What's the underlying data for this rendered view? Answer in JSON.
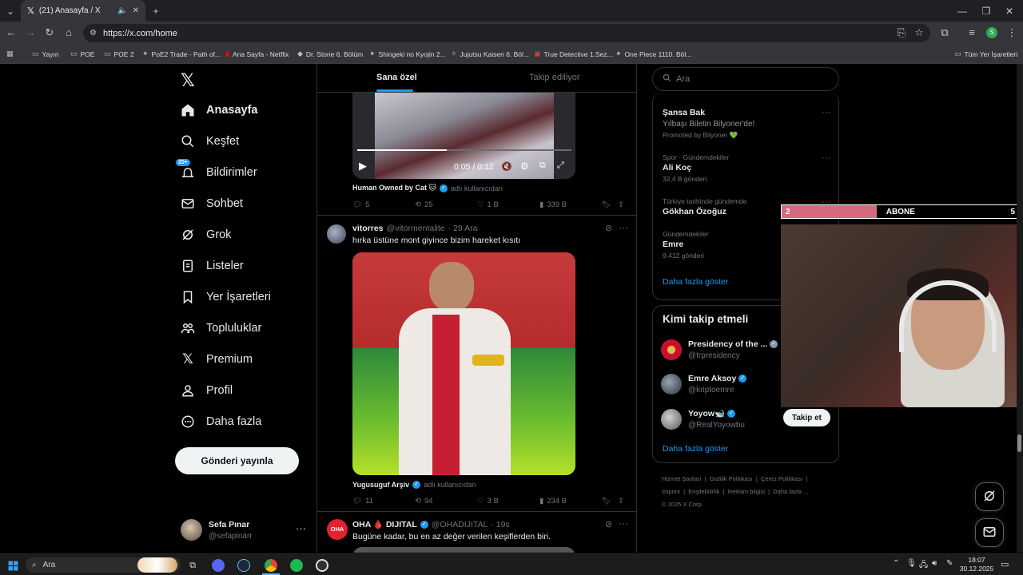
{
  "browser": {
    "tab_title": "(21) Anasayfa / X",
    "url": "https://x.com/home",
    "profile_initial": "S",
    "bookmarks": [
      "Yayın",
      "POE",
      "POE 2",
      "PoE2 Trade - Path of...",
      "Ana Sayfa - Netflix",
      "Dr. Stone 6. Bölüm",
      "Shingeki no Kyojin 2...",
      "Jujutsu Kaisen 6. Böl...",
      "True Detective 1.Sez...",
      "One Piece 1110. Böl..."
    ],
    "all_bookmarks": "Tüm Yer İşaretleri"
  },
  "nav": {
    "items": [
      {
        "label": "Anasayfa",
        "icon": "home-icon"
      },
      {
        "label": "Keşfet",
        "icon": "search-icon"
      },
      {
        "label": "Bildirimler",
        "icon": "bell-icon",
        "badge": "20+"
      },
      {
        "label": "Sohbet",
        "icon": "mail-icon"
      },
      {
        "label": "Grok",
        "icon": "grok-icon"
      },
      {
        "label": "Listeler",
        "icon": "list-icon"
      },
      {
        "label": "Yer İşaretleri",
        "icon": "bookmark-icon"
      },
      {
        "label": "Topluluklar",
        "icon": "communities-icon"
      },
      {
        "label": "Premium",
        "icon": "x-icon"
      },
      {
        "label": "Profil",
        "icon": "person-icon"
      },
      {
        "label": "Daha fazla",
        "icon": "more-circle-icon"
      }
    ],
    "post_button": "Gönderi yayınla",
    "account": {
      "name": "Sefa Pınar",
      "handle": "@sefapinarr"
    }
  },
  "feed": {
    "tabs": [
      "Sana özel",
      "Takip ediliyor"
    ],
    "video1": {
      "time": "0:05 / 0:12",
      "source_label": "Human Owned by Cat 🐱",
      "source_suffix": "adlı kullanıcıdan",
      "actions": {
        "replies": "5",
        "reposts": "25",
        "likes": "1 B",
        "views": "339 B"
      }
    },
    "tweet2": {
      "name": "vitorres",
      "handle": "@vitormentalite",
      "date": "· 29 Ara",
      "text": "hırka üstüne mont giyince bizim hareket kısıtı",
      "source_label": "Yugusuguf Arşiv",
      "source_suffix": "adlı kullanıcıdan",
      "actions": {
        "replies": "11",
        "reposts": "94",
        "likes": "3 B",
        "views": "234 B"
      }
    },
    "tweet3": {
      "avatar_text": "OHA",
      "name": "OHA 🩸 DIJITAL",
      "handle": "@OHADIJITAL",
      "date": "· 19s",
      "text": "Bugüne kadar, bu en az değer verilen keşiflerden biri."
    }
  },
  "sidebar": {
    "search_placeholder": "Ara",
    "trends": [
      {
        "context": "",
        "name": "Şansa Bak",
        "count": "Yılbaşı Biletin Bilyoner'de!",
        "promo": "Promoted by Bilyoner 💚"
      },
      {
        "context": "Spor · Gündemdekiler",
        "name": "Ali Koç",
        "count": "32,4 B gönderi"
      },
      {
        "context": "Türkiye tarihinde gündemde",
        "name": "Gökhan Özoğuz",
        "count": ""
      },
      {
        "context": "Gündemdekiler",
        "name": "Emre",
        "count": "9.412 gönderi"
      }
    ],
    "show_more": "Daha fazla göster",
    "who_to_follow": {
      "title": "Kimi takip etmeli",
      "accounts": [
        {
          "name": "Presidency of the ...",
          "handle": "@trpresidency"
        },
        {
          "name": "Emre Aksoy",
          "handle": "@kriptoemre"
        },
        {
          "name": "Yoyow🐋",
          "handle": "@RealYoyowbu"
        }
      ],
      "follow_label": "Takip et",
      "show_more": "Daha fazla göster"
    },
    "footer": [
      "Hizmet Şartları",
      "Gizlilik Politikası",
      "Çerez Politikası",
      "Imprint",
      "Erişilebilirlik",
      "Reklam bilgisi",
      "Daha fazla ...",
      "© 2025 X Corp."
    ]
  },
  "overlay": {
    "left_num": "2",
    "label": "ABONE",
    "right_num": "5"
  },
  "taskbar": {
    "search": "Ara",
    "time": "18:07",
    "date": "30.12.2025"
  },
  "colors": {
    "accent": "#1d9bf0",
    "overlay_pink": "#d46a7e"
  }
}
